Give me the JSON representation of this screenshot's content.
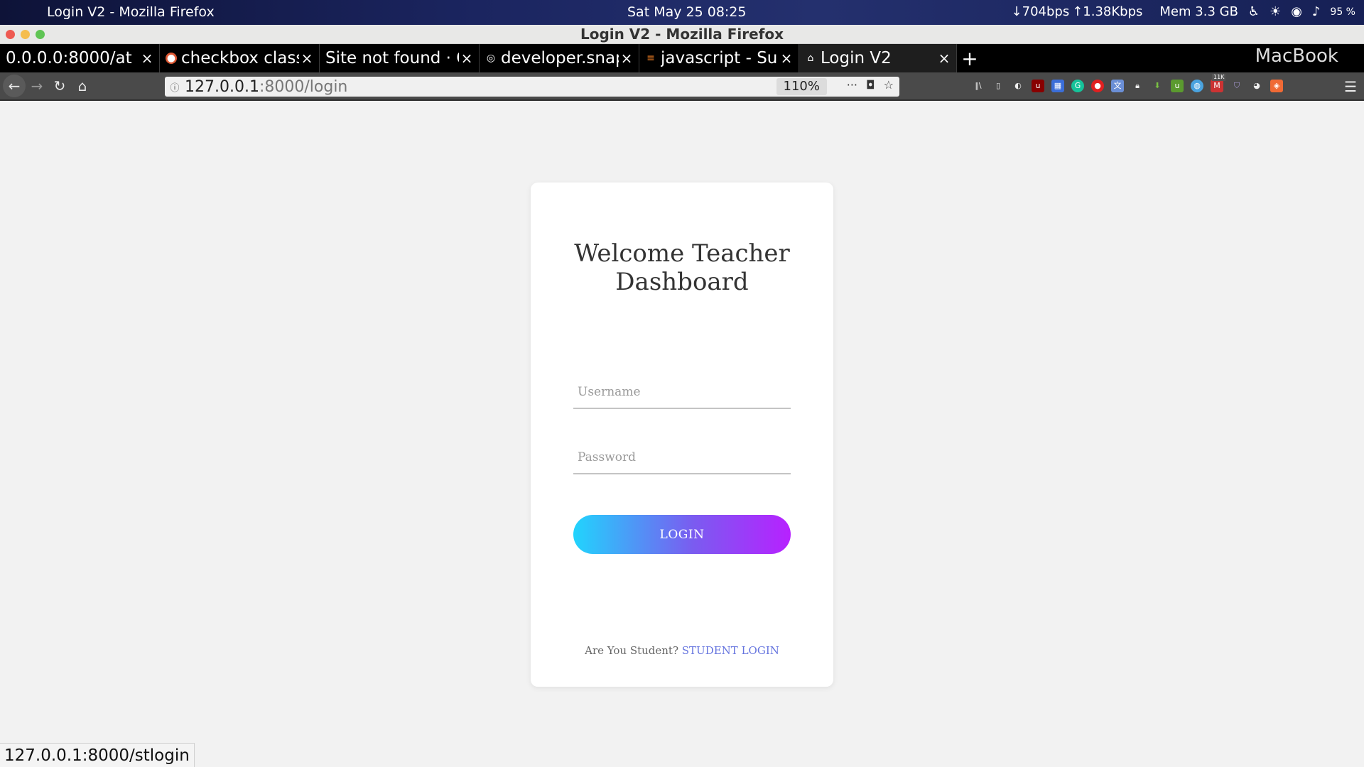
{
  "os": {
    "app_title": "Login V2 - Mozilla Firefox",
    "clock": "Sat May 25  08:25",
    "net_down": "↓704bps",
    "net_up": "↑1.38Kbps",
    "mem": "Mem 3.3 GB",
    "battery": "95 %"
  },
  "window": {
    "title": "Login V2 - Mozilla Firefox",
    "macbook_label": "MacBook"
  },
  "tabs": [
    {
      "label": "0.0.0.0:8000/at",
      "icon": "none"
    },
    {
      "label": "checkbox class",
      "icon": "duckduckgo-icon"
    },
    {
      "label": "Site not found · G",
      "icon": "none"
    },
    {
      "label": "developer.snap",
      "icon": "globe-icon"
    },
    {
      "label": "javascript - Sub",
      "icon": "stackoverflow-icon"
    },
    {
      "label": "Login V2",
      "icon": "home-icon"
    }
  ],
  "navbar": {
    "url_host": "127.0.0.1",
    "url_path": ":8000/login",
    "zoom": "110%",
    "ext_badge": "11K"
  },
  "page": {
    "title_line1": "Welcome Teacher",
    "title_line2": "Dashboard",
    "username_placeholder": "Username",
    "password_placeholder": "Password",
    "login_label": "LOGIN",
    "footer_text": "Are You Student?",
    "footer_link": "STUDENT LOGIN"
  },
  "status": {
    "hover_url": "127.0.0.1:8000/stlogin"
  },
  "colors": {
    "gradient_start": "#21d4fd",
    "gradient_end": "#b721ff",
    "link": "#6675df"
  }
}
